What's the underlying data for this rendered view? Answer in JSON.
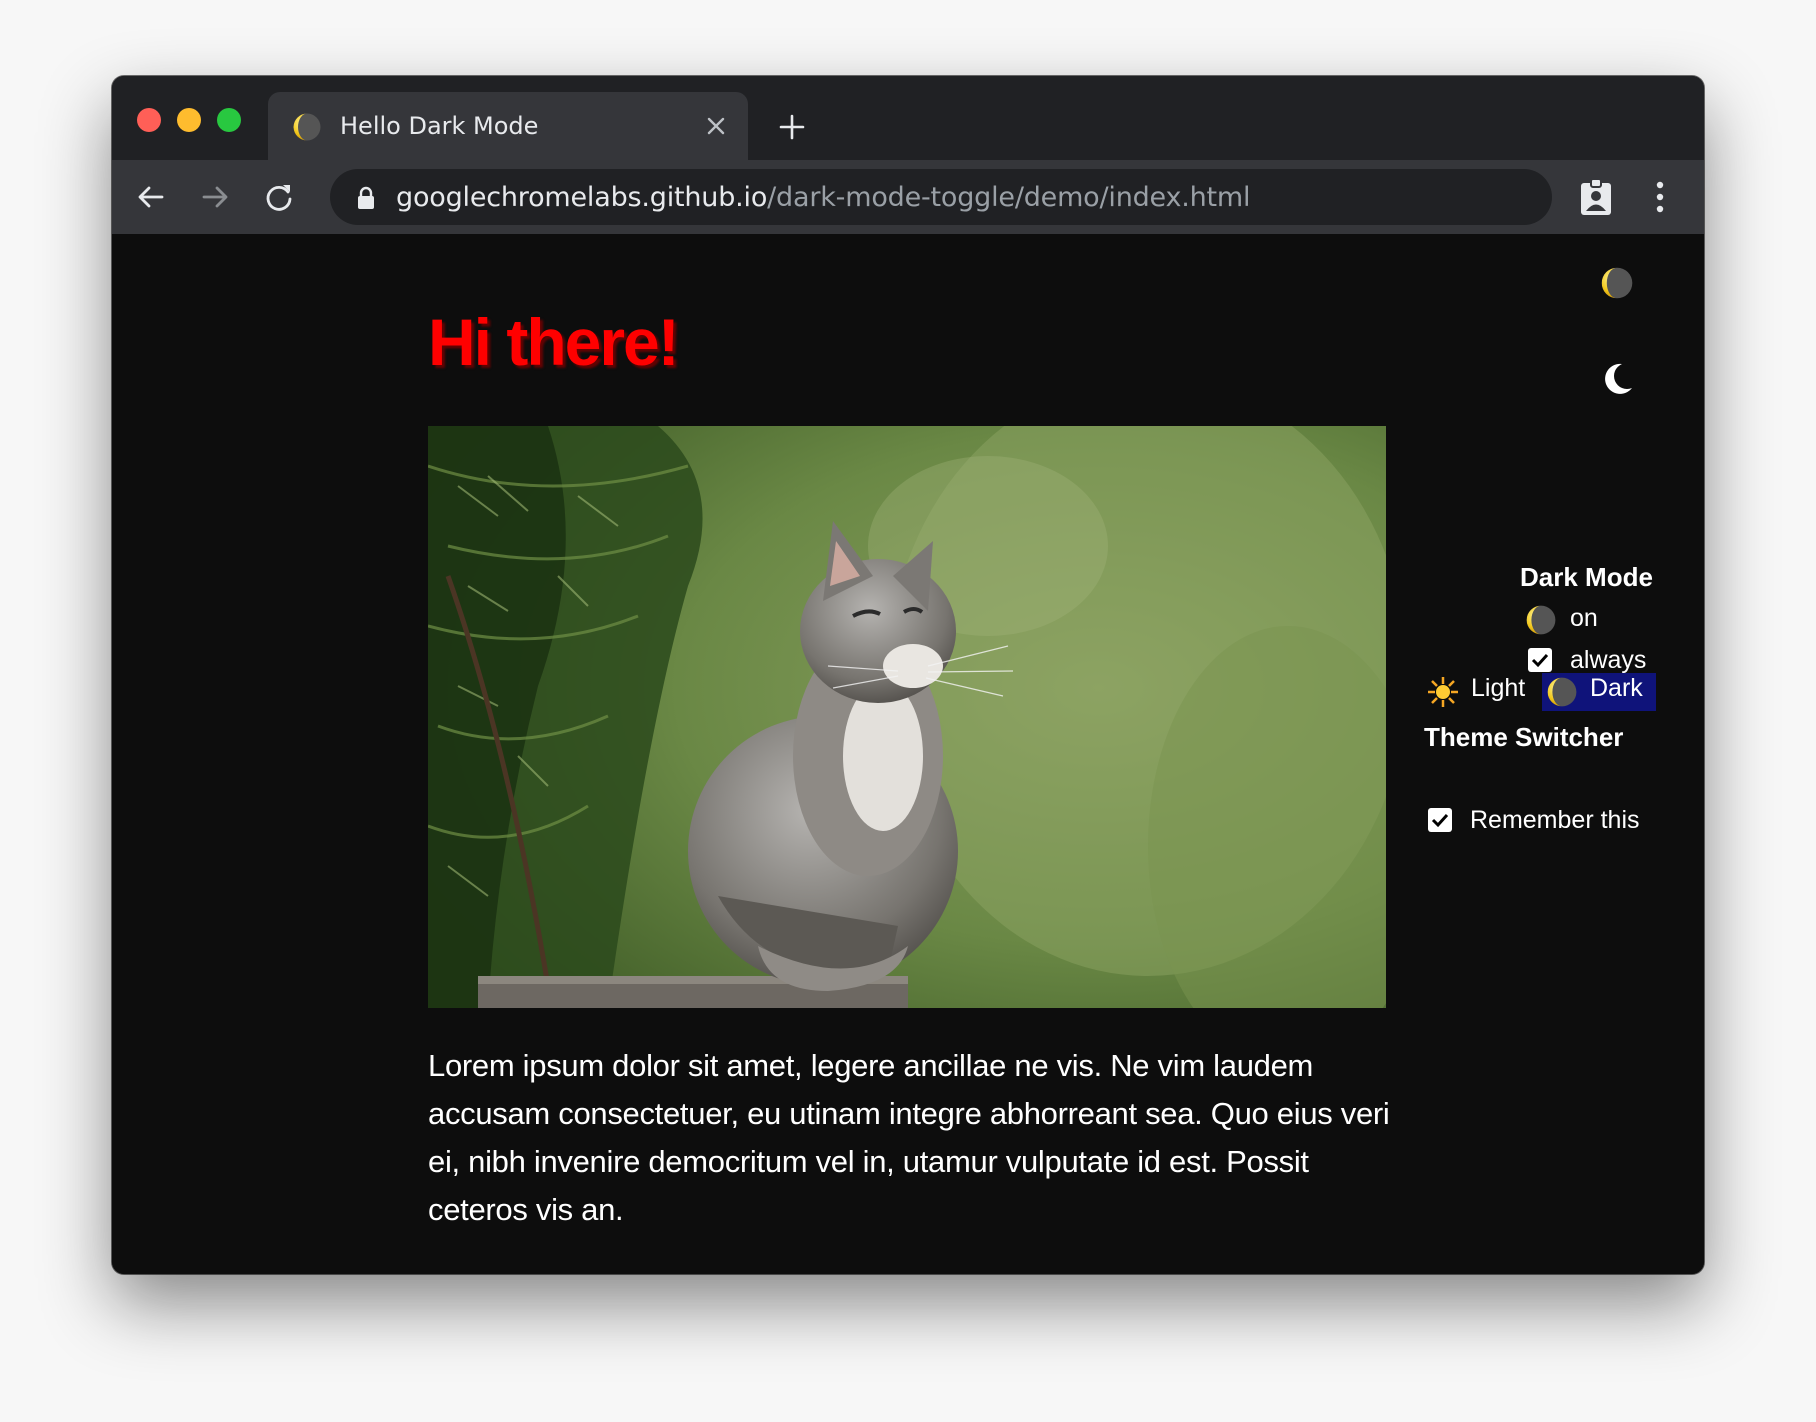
{
  "browser": {
    "tab_title": "Hello Dark Mode",
    "url_host": "googlechromelabs.github.io",
    "url_path": "/dark-mode-toggle/demo/index.html"
  },
  "page": {
    "heading": "Hi there!",
    "paragraph": "Lorem ipsum dolor sit amet, legere ancillae ne vis. Ne vim laudem accusam consectetuer, eu utinam integre abhorreant sea. Quo eius veri ei, nibh invenire democritum vel in, utamur vulputate id est. Possit ceteros vis an."
  },
  "dark_mode_toggle": {
    "title": "Dark Mode",
    "on_label": "on",
    "always_label": "always",
    "always_checked": true
  },
  "theme_switcher": {
    "title": "Theme Switcher",
    "light_label": "Light",
    "dark_label": "Dark",
    "selected": "Dark",
    "remember_label": "Remember this",
    "remember_checked": true
  },
  "icons": {
    "favicon": "crescent-moon-icon",
    "theme_light": "sun-icon",
    "theme_dark": "crescent-moon-icon"
  },
  "colors": {
    "heading": "#ff0000",
    "page_background": "#0d0d0d",
    "selected_background": "#0f137a"
  }
}
